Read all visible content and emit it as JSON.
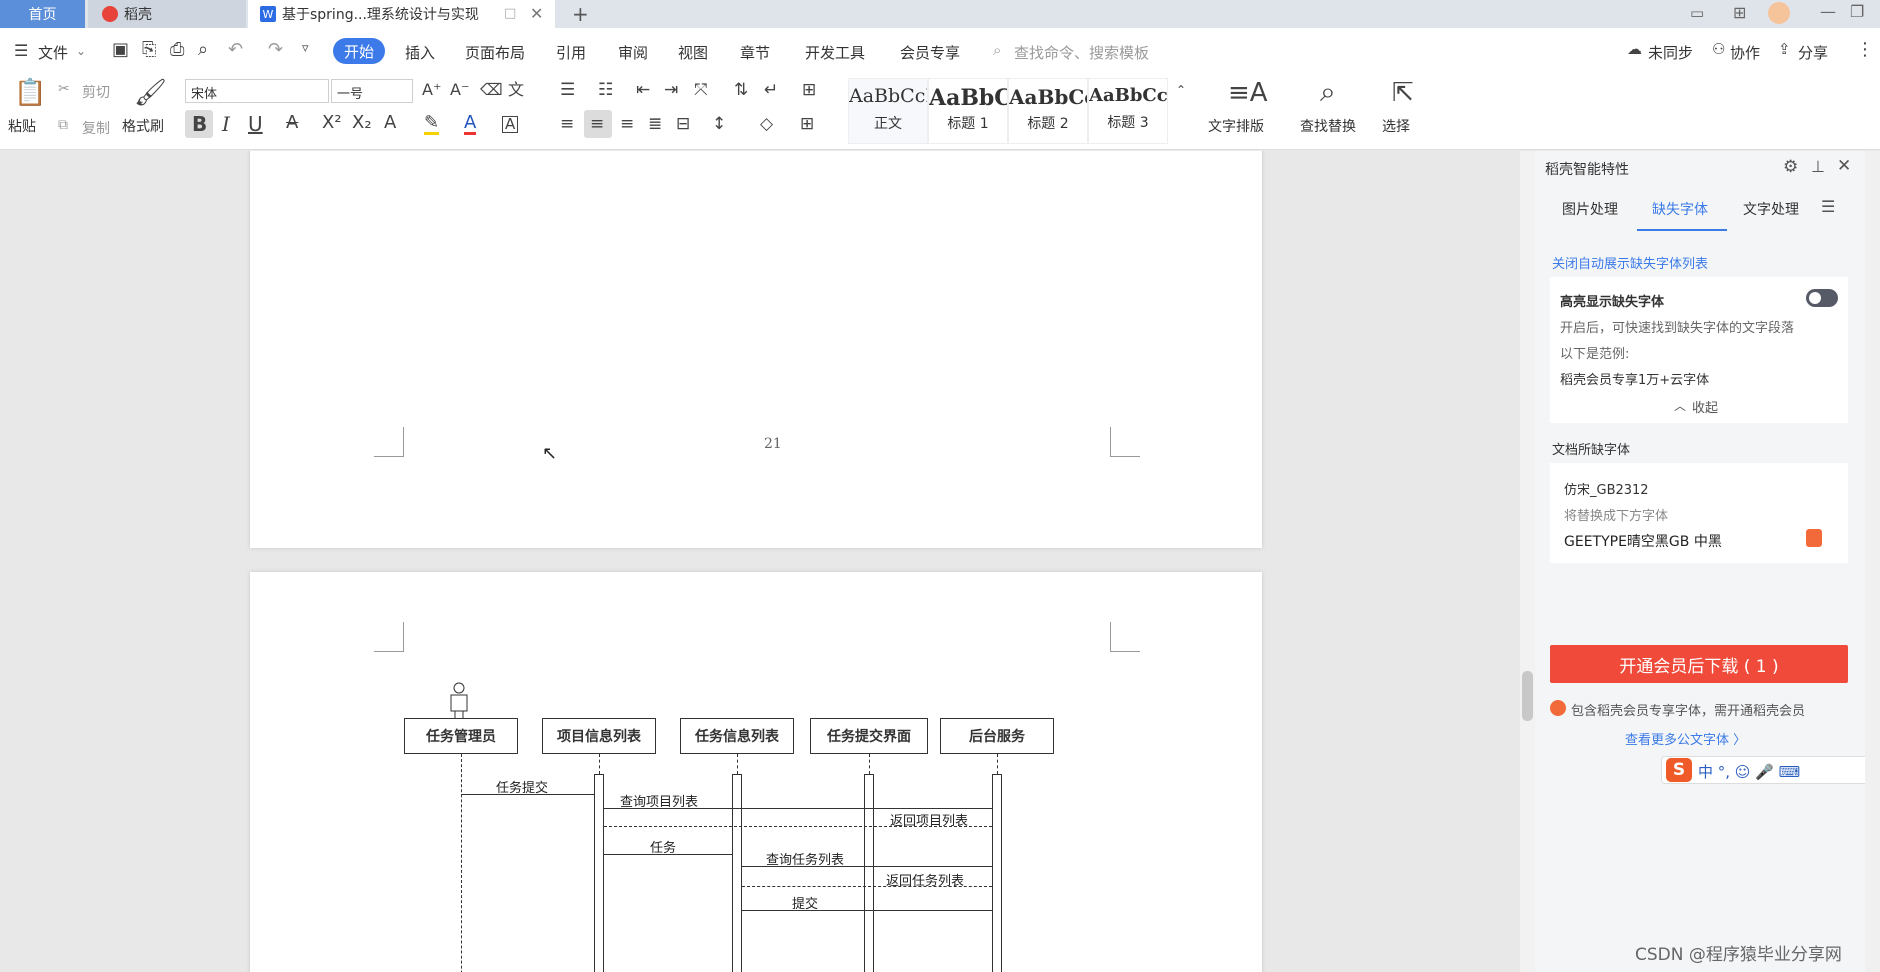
{
  "tabs": {
    "home": "首页",
    "daoke": "稻壳",
    "doc": "基于spring...理系统设计与实现"
  },
  "menu": {
    "file": "文件",
    "items": [
      "开始",
      "插入",
      "页面布局",
      "引用",
      "审阅",
      "视图",
      "章节",
      "开发工具",
      "会员专享"
    ],
    "search_placeholder": "查找命令、搜索模板",
    "sync": "未同步",
    "collab": "协作",
    "share": "分享"
  },
  "ribbon": {
    "paste": "粘贴",
    "cut": "剪切",
    "copy": "复制",
    "format_painter": "格式刷",
    "font_name": "宋体",
    "font_size": "一号",
    "styles": [
      {
        "sample": "AaBbCcDd",
        "name": "正文"
      },
      {
        "sample": "AaBbC",
        "name": "标题 1"
      },
      {
        "sample": "AaBbCc",
        "name": "标题 2"
      },
      {
        "sample": "AaBbCcI",
        "name": "标题 3"
      }
    ],
    "text_layout": "文字排版",
    "find_replace": "查找替换",
    "select": "选择"
  },
  "document": {
    "page_number": "21",
    "diagram": {
      "actors": [
        "任务管理员",
        "项目信息列表",
        "任务信息列表",
        "任务提交界面",
        "后台服务"
      ],
      "messages": [
        "任务提交",
        "查询项目列表",
        "返回项目列表",
        "任务",
        "查询任务列表",
        "返回任务列表",
        "提交"
      ]
    }
  },
  "sidebar": {
    "title": "稻壳智能特性",
    "tabs": [
      "图片处理",
      "缺失字体",
      "文字处理"
    ],
    "active_tab": "缺失字体",
    "close_auto_link": "关闭自动展示缺失字体列表",
    "highlight_title": "高亮显示缺失字体",
    "highlight_desc": "开启后，可快速找到缺失字体的文字段落",
    "example_label": "以下是范例:",
    "example_text": "稻壳会员专享1万+云字体",
    "collapse": "收起",
    "missing_title": "文档所缺字体",
    "missing_font": "仿宋_GB2312",
    "replace_label": "将替换成下方字体",
    "replace_font": "GEETYPE晴空黑GB 中黑",
    "vip_button": "开通会员后下载 ( 1 )",
    "vip_note": "包含稻壳会员专享字体，需开通稻壳会员",
    "more_link": "查看更多公文字体 〉"
  },
  "watermark": "CSDN @程序猿毕业分享网",
  "colors": {
    "accent": "#3b7ae8",
    "vip_red": "#f04a3a",
    "home_tab": "#5b8fd9"
  }
}
